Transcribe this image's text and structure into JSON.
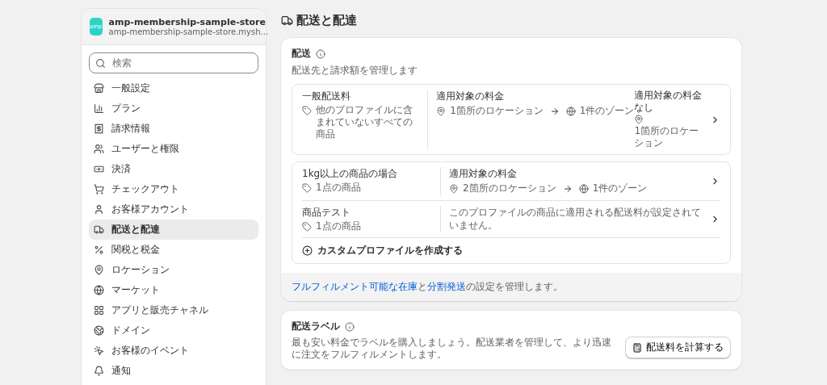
{
  "store": {
    "badge": "amp",
    "name": "amp-membership-sample-store",
    "domain": "amp-membership-sample-store.mysh..."
  },
  "search": {
    "placeholder": "検索"
  },
  "nav": [
    {
      "label": "一般設定",
      "selected": false
    },
    {
      "label": "プラン",
      "selected": false
    },
    {
      "label": "請求情報",
      "selected": false
    },
    {
      "label": "ユーザーと権限",
      "selected": false
    },
    {
      "label": "決済",
      "selected": false
    },
    {
      "label": "チェックアウト",
      "selected": false
    },
    {
      "label": "お客様アカウント",
      "selected": false
    },
    {
      "label": "配送と配達",
      "selected": true
    },
    {
      "label": "関税と税金",
      "selected": false
    },
    {
      "label": "ロケーション",
      "selected": false
    },
    {
      "label": "マーケット",
      "selected": false
    },
    {
      "label": "アプリと販売チャネル",
      "selected": false
    },
    {
      "label": "ドメイン",
      "selected": false
    },
    {
      "label": "お客様のイベント",
      "selected": false
    },
    {
      "label": "通知",
      "selected": false
    }
  ],
  "page_title": "配送と配達",
  "shipping": {
    "title": "配送",
    "description": "配送先と請求額を管理します",
    "groups": [
      {
        "profiles": [
          {
            "kind": "rates",
            "name": "一般配送料",
            "items": "他のプロファイルに含まれていないすべての商品",
            "rates_title": "適用対象の料金",
            "origin": "1箇所のロケーション",
            "zones": "1件のゾーン",
            "no_rates": {
              "title": "適用対象の料金なし",
              "origin": "1箇所のロケーション"
            }
          }
        ]
      },
      {
        "profiles": [
          {
            "kind": "rates",
            "name": "1kg以上の商品の場合",
            "items": "1点の商品",
            "rates_title": "適用対象の料金",
            "origin": "2箇所のロケーション",
            "zones": "1件のゾーン"
          },
          {
            "kind": "empty",
            "name": "商品テスト",
            "items": "1点の商品",
            "message": "このプロファイルの商品に適用される配送料が設定されていません。"
          }
        ],
        "create_action": "カスタムプロファイルを作成する"
      }
    ],
    "footer": [
      {
        "kind": "link",
        "text": "フルフィルメント可能な在庫"
      },
      {
        "kind": "text",
        "text": "と"
      },
      {
        "kind": "link",
        "text": "分割発送"
      },
      {
        "kind": "text",
        "text": "の設定を管理します。"
      }
    ]
  },
  "labels": {
    "title": "配送ラベル",
    "description": "最も安い料金でラベルを購入しましょう。配送業者を管理して、より迅速に注文をフルフィルメントします。",
    "button": "配送料を計算する"
  }
}
